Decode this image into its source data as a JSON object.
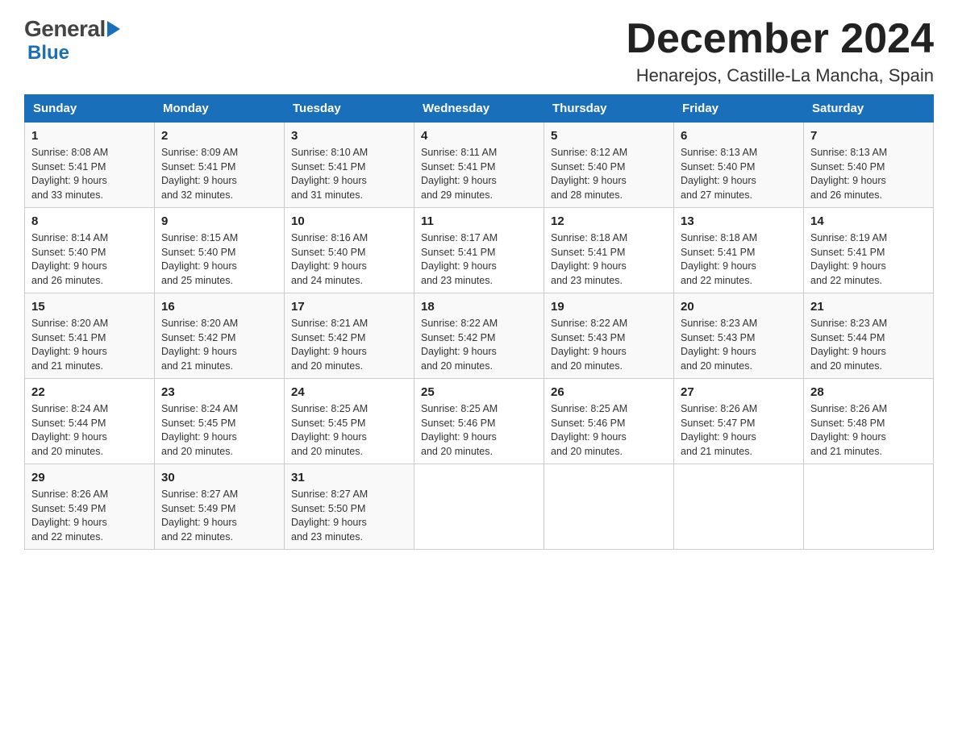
{
  "logo": {
    "general": "General",
    "blue": "Blue"
  },
  "title": "December 2024",
  "location": "Henarejos, Castille-La Mancha, Spain",
  "headers": [
    "Sunday",
    "Monday",
    "Tuesday",
    "Wednesday",
    "Thursday",
    "Friday",
    "Saturday"
  ],
  "weeks": [
    [
      {
        "day": "1",
        "sunrise": "Sunrise: 8:08 AM",
        "sunset": "Sunset: 5:41 PM",
        "daylight": "Daylight: 9 hours\nand 33 minutes."
      },
      {
        "day": "2",
        "sunrise": "Sunrise: 8:09 AM",
        "sunset": "Sunset: 5:41 PM",
        "daylight": "Daylight: 9 hours\nand 32 minutes."
      },
      {
        "day": "3",
        "sunrise": "Sunrise: 8:10 AM",
        "sunset": "Sunset: 5:41 PM",
        "daylight": "Daylight: 9 hours\nand 31 minutes."
      },
      {
        "day": "4",
        "sunrise": "Sunrise: 8:11 AM",
        "sunset": "Sunset: 5:41 PM",
        "daylight": "Daylight: 9 hours\nand 29 minutes."
      },
      {
        "day": "5",
        "sunrise": "Sunrise: 8:12 AM",
        "sunset": "Sunset: 5:40 PM",
        "daylight": "Daylight: 9 hours\nand 28 minutes."
      },
      {
        "day": "6",
        "sunrise": "Sunrise: 8:13 AM",
        "sunset": "Sunset: 5:40 PM",
        "daylight": "Daylight: 9 hours\nand 27 minutes."
      },
      {
        "day": "7",
        "sunrise": "Sunrise: 8:13 AM",
        "sunset": "Sunset: 5:40 PM",
        "daylight": "Daylight: 9 hours\nand 26 minutes."
      }
    ],
    [
      {
        "day": "8",
        "sunrise": "Sunrise: 8:14 AM",
        "sunset": "Sunset: 5:40 PM",
        "daylight": "Daylight: 9 hours\nand 26 minutes."
      },
      {
        "day": "9",
        "sunrise": "Sunrise: 8:15 AM",
        "sunset": "Sunset: 5:40 PM",
        "daylight": "Daylight: 9 hours\nand 25 minutes."
      },
      {
        "day": "10",
        "sunrise": "Sunrise: 8:16 AM",
        "sunset": "Sunset: 5:40 PM",
        "daylight": "Daylight: 9 hours\nand 24 minutes."
      },
      {
        "day": "11",
        "sunrise": "Sunrise: 8:17 AM",
        "sunset": "Sunset: 5:41 PM",
        "daylight": "Daylight: 9 hours\nand 23 minutes."
      },
      {
        "day": "12",
        "sunrise": "Sunrise: 8:18 AM",
        "sunset": "Sunset: 5:41 PM",
        "daylight": "Daylight: 9 hours\nand 23 minutes."
      },
      {
        "day": "13",
        "sunrise": "Sunrise: 8:18 AM",
        "sunset": "Sunset: 5:41 PM",
        "daylight": "Daylight: 9 hours\nand 22 minutes."
      },
      {
        "day": "14",
        "sunrise": "Sunrise: 8:19 AM",
        "sunset": "Sunset: 5:41 PM",
        "daylight": "Daylight: 9 hours\nand 22 minutes."
      }
    ],
    [
      {
        "day": "15",
        "sunrise": "Sunrise: 8:20 AM",
        "sunset": "Sunset: 5:41 PM",
        "daylight": "Daylight: 9 hours\nand 21 minutes."
      },
      {
        "day": "16",
        "sunrise": "Sunrise: 8:20 AM",
        "sunset": "Sunset: 5:42 PM",
        "daylight": "Daylight: 9 hours\nand 21 minutes."
      },
      {
        "day": "17",
        "sunrise": "Sunrise: 8:21 AM",
        "sunset": "Sunset: 5:42 PM",
        "daylight": "Daylight: 9 hours\nand 20 minutes."
      },
      {
        "day": "18",
        "sunrise": "Sunrise: 8:22 AM",
        "sunset": "Sunset: 5:42 PM",
        "daylight": "Daylight: 9 hours\nand 20 minutes."
      },
      {
        "day": "19",
        "sunrise": "Sunrise: 8:22 AM",
        "sunset": "Sunset: 5:43 PM",
        "daylight": "Daylight: 9 hours\nand 20 minutes."
      },
      {
        "day": "20",
        "sunrise": "Sunrise: 8:23 AM",
        "sunset": "Sunset: 5:43 PM",
        "daylight": "Daylight: 9 hours\nand 20 minutes."
      },
      {
        "day": "21",
        "sunrise": "Sunrise: 8:23 AM",
        "sunset": "Sunset: 5:44 PM",
        "daylight": "Daylight: 9 hours\nand 20 minutes."
      }
    ],
    [
      {
        "day": "22",
        "sunrise": "Sunrise: 8:24 AM",
        "sunset": "Sunset: 5:44 PM",
        "daylight": "Daylight: 9 hours\nand 20 minutes."
      },
      {
        "day": "23",
        "sunrise": "Sunrise: 8:24 AM",
        "sunset": "Sunset: 5:45 PM",
        "daylight": "Daylight: 9 hours\nand 20 minutes."
      },
      {
        "day": "24",
        "sunrise": "Sunrise: 8:25 AM",
        "sunset": "Sunset: 5:45 PM",
        "daylight": "Daylight: 9 hours\nand 20 minutes."
      },
      {
        "day": "25",
        "sunrise": "Sunrise: 8:25 AM",
        "sunset": "Sunset: 5:46 PM",
        "daylight": "Daylight: 9 hours\nand 20 minutes."
      },
      {
        "day": "26",
        "sunrise": "Sunrise: 8:25 AM",
        "sunset": "Sunset: 5:46 PM",
        "daylight": "Daylight: 9 hours\nand 20 minutes."
      },
      {
        "day": "27",
        "sunrise": "Sunrise: 8:26 AM",
        "sunset": "Sunset: 5:47 PM",
        "daylight": "Daylight: 9 hours\nand 21 minutes."
      },
      {
        "day": "28",
        "sunrise": "Sunrise: 8:26 AM",
        "sunset": "Sunset: 5:48 PM",
        "daylight": "Daylight: 9 hours\nand 21 minutes."
      }
    ],
    [
      {
        "day": "29",
        "sunrise": "Sunrise: 8:26 AM",
        "sunset": "Sunset: 5:49 PM",
        "daylight": "Daylight: 9 hours\nand 22 minutes."
      },
      {
        "day": "30",
        "sunrise": "Sunrise: 8:27 AM",
        "sunset": "Sunset: 5:49 PM",
        "daylight": "Daylight: 9 hours\nand 22 minutes."
      },
      {
        "day": "31",
        "sunrise": "Sunrise: 8:27 AM",
        "sunset": "Sunset: 5:50 PM",
        "daylight": "Daylight: 9 hours\nand 23 minutes."
      },
      null,
      null,
      null,
      null
    ]
  ]
}
